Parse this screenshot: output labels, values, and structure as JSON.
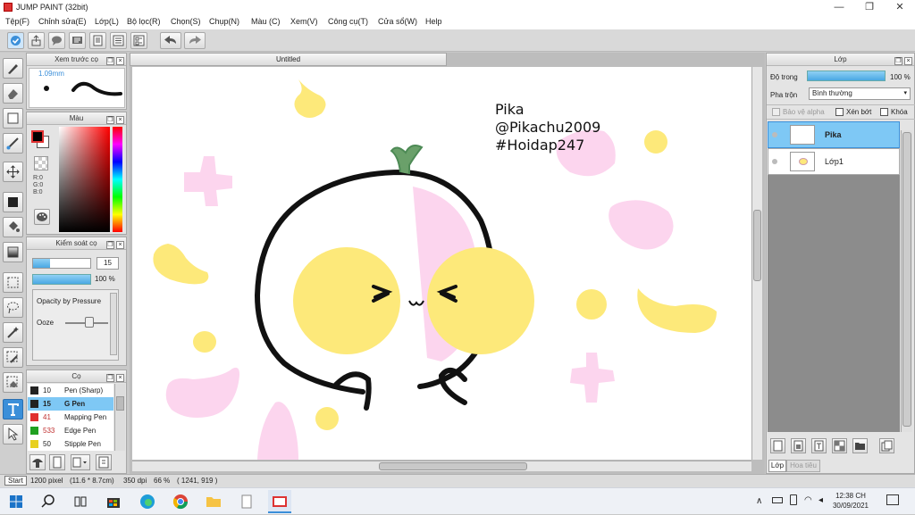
{
  "app": {
    "title": "JUMP PAINT (32bit)"
  },
  "window_buttons": {
    "minimize": "—",
    "restore": "❐",
    "close": "✕"
  },
  "menu": [
    "Tệp(F)",
    "Chỉnh sửa(E)",
    "Lớp(L)",
    "Bộ lọc(R)",
    "Chọn(S)",
    "Chụp(N)",
    "Màu (C)",
    "Xem(V)",
    "Công cụ(T)",
    "Cửa sổ(W)",
    "Help"
  ],
  "canvas_tab": "Untitled",
  "brush_preview": {
    "title": "Xem trước cọ",
    "size": "1.09mm"
  },
  "color_panel": {
    "title": "Màu",
    "r": "R:0",
    "g": "G:0",
    "b": "B:0"
  },
  "brush_control": {
    "title": "Kiểm soát cọ",
    "size_value": "15",
    "opacity_value": "100 %",
    "pressure_label": "Opacity by Pressure",
    "ooze_label": "Ooze"
  },
  "brush_list": {
    "title": "Cọ",
    "items": [
      {
        "size": "10",
        "name": "Pen (Sharp)",
        "color": "#222222",
        "selected": false
      },
      {
        "size": "15",
        "name": "G Pen",
        "color": "#222222",
        "selected": true
      },
      {
        "size": "41",
        "name": "Mapping Pen",
        "color": "#e03030",
        "selected": false
      },
      {
        "size": "533",
        "name": "Edge Pen",
        "color": "#20a020",
        "selected": false
      },
      {
        "size": "50",
        "name": "Stipple Pen",
        "color": "#e8d020",
        "selected": false
      }
    ]
  },
  "layer_panel": {
    "title": "Lớp",
    "opacity_label": "Độ trong",
    "opacity_value": "100 %",
    "blend_label": "Pha trộn",
    "blend_value": "Bình thường",
    "protect_alpha": "Bảo vệ alpha",
    "clipping": "Xén bớt",
    "lock": "Khóa",
    "layers": [
      {
        "name": "Pika",
        "selected": true
      },
      {
        "name": "Lớp1",
        "selected": false
      }
    ],
    "tabs": [
      "Lớp",
      "Hoa tiêu"
    ]
  },
  "artwork_text": {
    "line1": "Pika",
    "line2": "@Pikachu2009",
    "line3": "#Hoidap247"
  },
  "status": {
    "start_tooltip": "Start",
    "size": "1200 pixel",
    "physical": "(11.6 * 8.7cm)",
    "dpi": "350 dpi",
    "zoom": "66 %",
    "cursor": "( 1241, 919 )"
  },
  "taskbar": {
    "time": "12:38 CH",
    "date": "30/09/2021"
  },
  "colors": {
    "accent": "#3b8fd9",
    "selection": "#7ec8f5",
    "pink": "#fcd5ee",
    "yellow": "#fde97a"
  }
}
